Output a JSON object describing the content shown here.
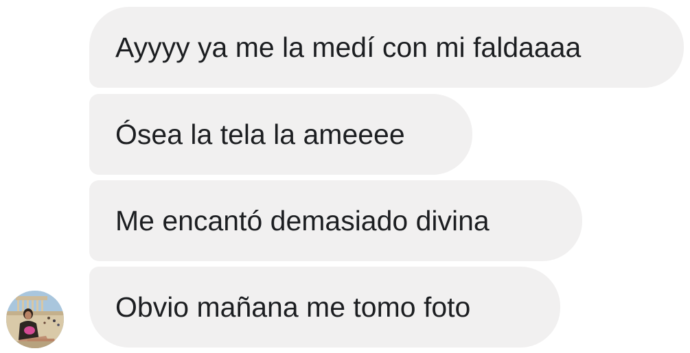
{
  "messages": [
    {
      "text": "Ayyyy ya me la medí con mi faldaaaa"
    },
    {
      "text": "Ósea la tela la ameeee"
    },
    {
      "text": "Me encantó demasiado divina"
    },
    {
      "text": "Obvio mañana me tomo foto"
    }
  ],
  "colors": {
    "bubble_bg": "#f1f0f0",
    "bubble_text": "#1c1e21"
  },
  "avatar": {
    "icon": "contact-avatar-photo"
  }
}
